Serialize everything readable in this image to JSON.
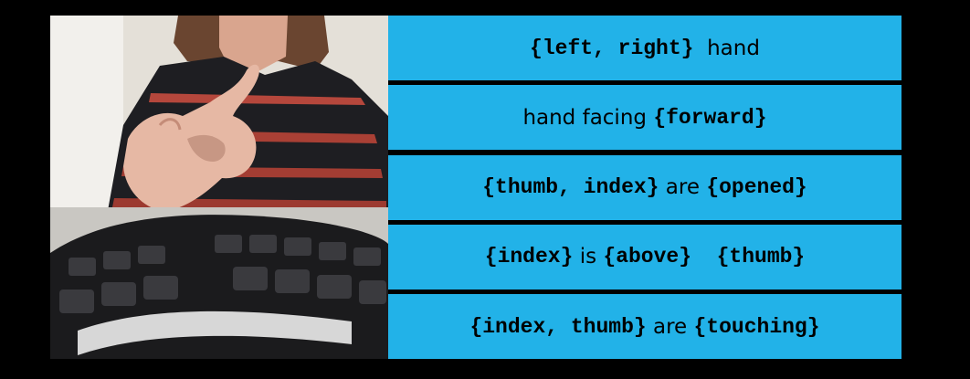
{
  "rows": [
    {
      "segments": [
        {
          "text": "{left, right}",
          "kind": "kw"
        },
        {
          "text": "  hand",
          "kind": "nl"
        }
      ]
    },
    {
      "segments": [
        {
          "text": "hand facing ",
          "kind": "nl"
        },
        {
          "text": "{forward}",
          "kind": "kw"
        }
      ]
    },
    {
      "segments": [
        {
          "text": "{thumb, index}",
          "kind": "kw"
        },
        {
          "text": " are ",
          "kind": "nl"
        },
        {
          "text": "{opened}",
          "kind": "kw"
        }
      ]
    },
    {
      "segments": [
        {
          "text": "{index}",
          "kind": "kw"
        },
        {
          "text": " is ",
          "kind": "nl"
        },
        {
          "text": "{above}  {thumb}",
          "kind": "kw"
        }
      ]
    },
    {
      "segments": [
        {
          "text": "{index, thumb}",
          "kind": "kw"
        },
        {
          "text": " are ",
          "kind": "nl"
        },
        {
          "text": "{touching}",
          "kind": "kw"
        }
      ]
    }
  ],
  "colors": {
    "panel_background": "#22b2e8",
    "page_background": "#000000",
    "text": "#000000"
  }
}
